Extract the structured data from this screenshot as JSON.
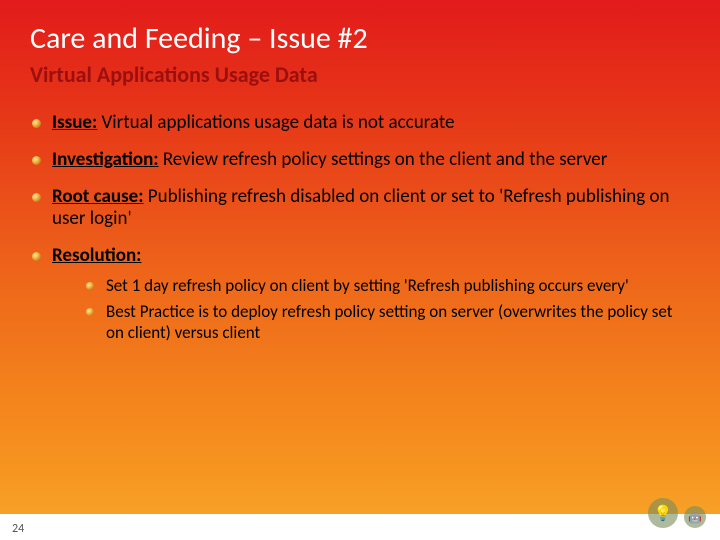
{
  "title": "Care and Feeding – Issue #2",
  "subtitle": "Virtual Applications Usage Data",
  "bullets": [
    {
      "label": "Issue:",
      "text": " Virtual applications usage data is not accurate"
    },
    {
      "label": "Investigation:",
      "text": " Review refresh policy settings on the client and the server"
    },
    {
      "label": "Root cause:",
      "text": " Publishing refresh disabled on client or set to 'Refresh publishing on user login'"
    },
    {
      "label": "Resolution:",
      "text": ""
    }
  ],
  "sub_bullets": [
    "Set 1 day refresh policy on client by setting 'Refresh publishing occurs every'",
    "Best Practice is to deploy refresh policy setting on server (overwrites the policy set on client) versus client"
  ],
  "page_number": "24",
  "icons": {
    "bulb": "💡",
    "robot": "🤖"
  }
}
